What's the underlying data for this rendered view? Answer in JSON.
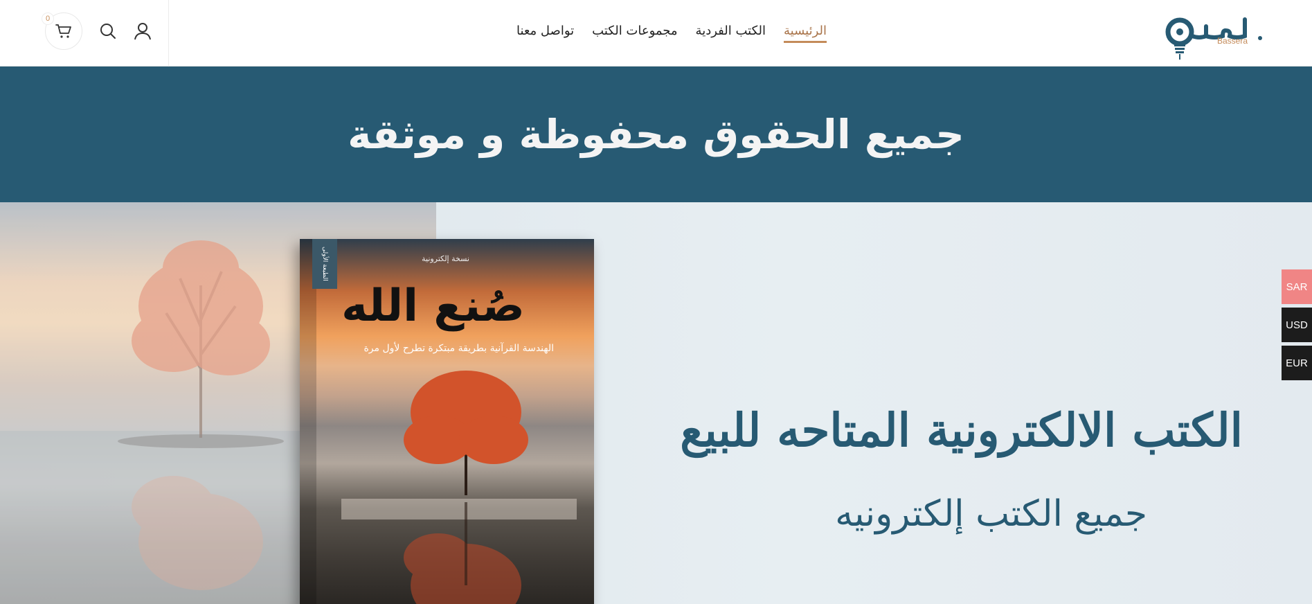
{
  "header": {
    "cart_count": "0",
    "nav": [
      {
        "label": "الرئيسية",
        "active": true
      },
      {
        "label": "الكتب الفردية",
        "active": false
      },
      {
        "label": "مجموعات الكتب",
        "active": false
      },
      {
        "label": "تواصل معنا",
        "active": false
      }
    ],
    "logo": {
      "arabic": "بصيرة",
      "latin": "Bassera"
    },
    "icons": {
      "cart": "cart-icon",
      "search": "search-icon",
      "account": "user-icon"
    }
  },
  "banner": {
    "title": "جميع الحقوق محفوظة و موثقة"
  },
  "hero": {
    "headline": "الكتب الالكترونية المتاحه للبيع",
    "subheadline": "جميع الكتب إلكترونيه",
    "book": {
      "tag": "نسخة إلكترونية",
      "edition": "الطبعة الأولى",
      "title": "صُنع الله",
      "subtitle": "الهندسة القرآنية بطريقة مبتكرة تطرح لأول مرة"
    }
  },
  "currencies": [
    {
      "code": "SAR",
      "color": "#f08585"
    },
    {
      "code": "USD",
      "color": "#1c1c1c"
    },
    {
      "code": "EUR",
      "color": "#1c1c1c"
    }
  ],
  "colors": {
    "brand_blue": "#275a73",
    "accent": "#c48b5a"
  }
}
